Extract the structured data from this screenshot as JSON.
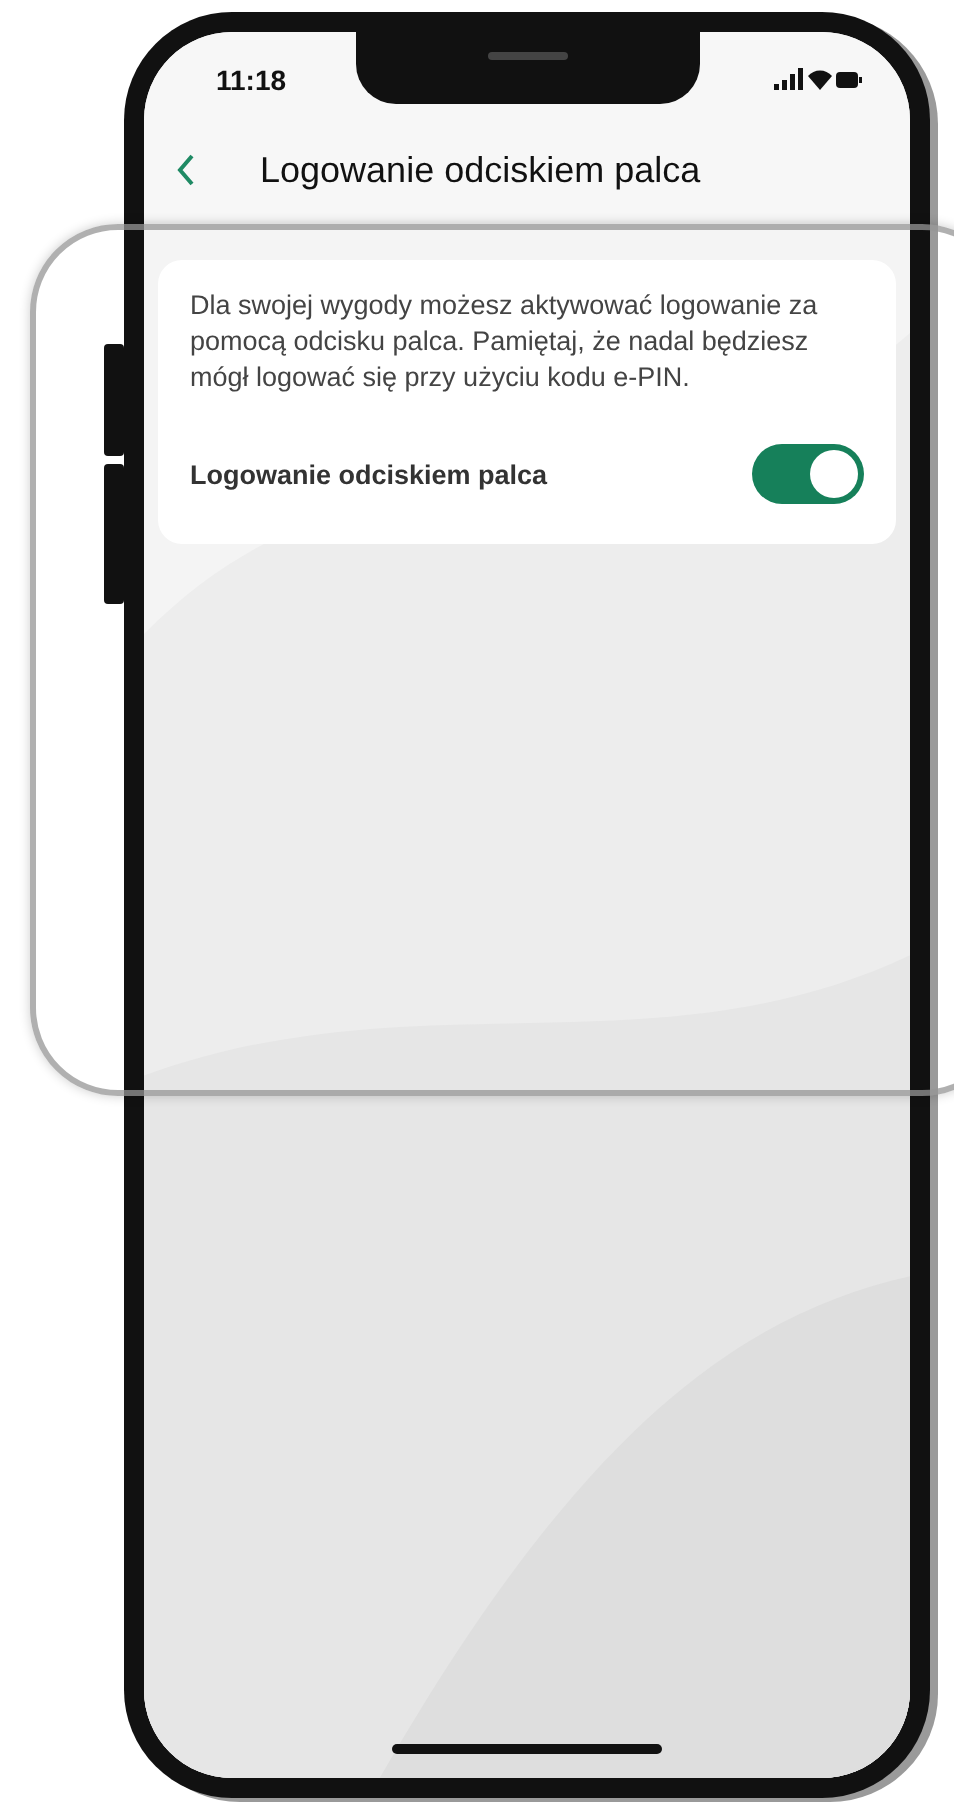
{
  "status_bar": {
    "time": "11:18"
  },
  "header": {
    "title": "Logowanie odciskiem palca"
  },
  "card": {
    "description": "Dla swojej wygody możesz aktywować logowanie za pomocą odcisku palca. Pamiętaj, że nadal będziesz mógł logować się przy użyciu kodu e-PIN.",
    "toggle": {
      "label": "Logowanie odciskiem palca",
      "on": true
    }
  }
}
